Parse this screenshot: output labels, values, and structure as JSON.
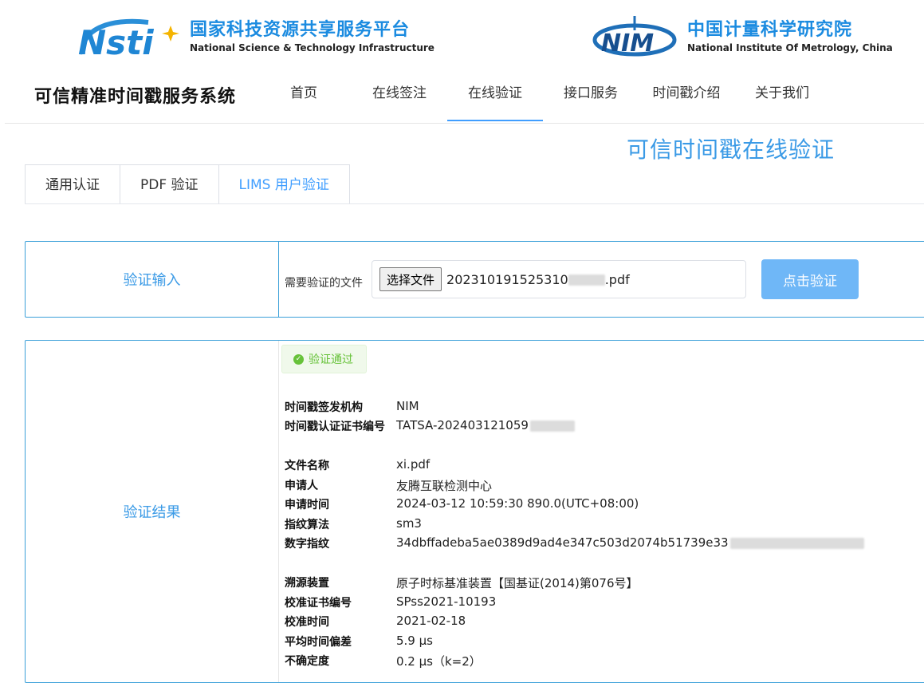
{
  "logos": {
    "nsti": {
      "cn": "国家科技资源共享服务平台",
      "en": "National Science & Technology Infrastructure"
    },
    "nim": {
      "cn": "中国计量科学研究院",
      "en": "National Institute Of Metrology, China"
    }
  },
  "brand": "可信精准时间戳服务系统",
  "nav": [
    "首页",
    "在线签注",
    "在线验证",
    "接口服务",
    "时间戳介绍",
    "关于我们"
  ],
  "page_title": "可信时间戳在线验证",
  "tabs": [
    "通用认证",
    "PDF 验证",
    "LIMS 用户验证"
  ],
  "input_panel": {
    "label": "验证输入",
    "file_label": "需要验证的文件",
    "choose_button": "选择文件",
    "file_name_prefix": "202310191525310",
    "file_name_suffix": ".pdf",
    "verify_button": "点击验证"
  },
  "result_panel": {
    "label": "验证结果",
    "status": "验证通过",
    "fields": {
      "issuer": {
        "k": "时间戳签发机构",
        "v": "NIM"
      },
      "cert_no": {
        "k": "时间戳认证证书编号",
        "v": "TATSA-202403121059"
      },
      "file_name": {
        "k": "文件名称",
        "v": "xi.pdf"
      },
      "applicant": {
        "k": "申请人",
        "v": "友腾互联检测中心"
      },
      "apply_time": {
        "k": "申请时间",
        "v": "2024-03-12 10:59:30 890.0(UTC+08:00)"
      },
      "algorithm": {
        "k": "指纹算法",
        "v": "sm3"
      },
      "digest": {
        "k": "数字指纹",
        "v": "34dbffadeba5ae0389d9ad4e347c503d2074b51739e33"
      },
      "source": {
        "k": "溯源装置",
        "v": "原子时标基准装置【国基证(2014)第076号】"
      },
      "calib_no": {
        "k": "校准证书编号",
        "v": "SPss2021-10193"
      },
      "calib_time": {
        "k": "校准时间",
        "v": "2021-02-18"
      },
      "avg_offset": {
        "k": "平均时间偏差",
        "v": "5.9 μs"
      },
      "uncertainty": {
        "k": "不确定度",
        "v": "0.2 μs（k=2）"
      }
    }
  },
  "colors": {
    "accent": "#409eff",
    "title_blue": "#3a9ae6",
    "success": "#67c23a",
    "verify_button": "#6fb7f7"
  }
}
